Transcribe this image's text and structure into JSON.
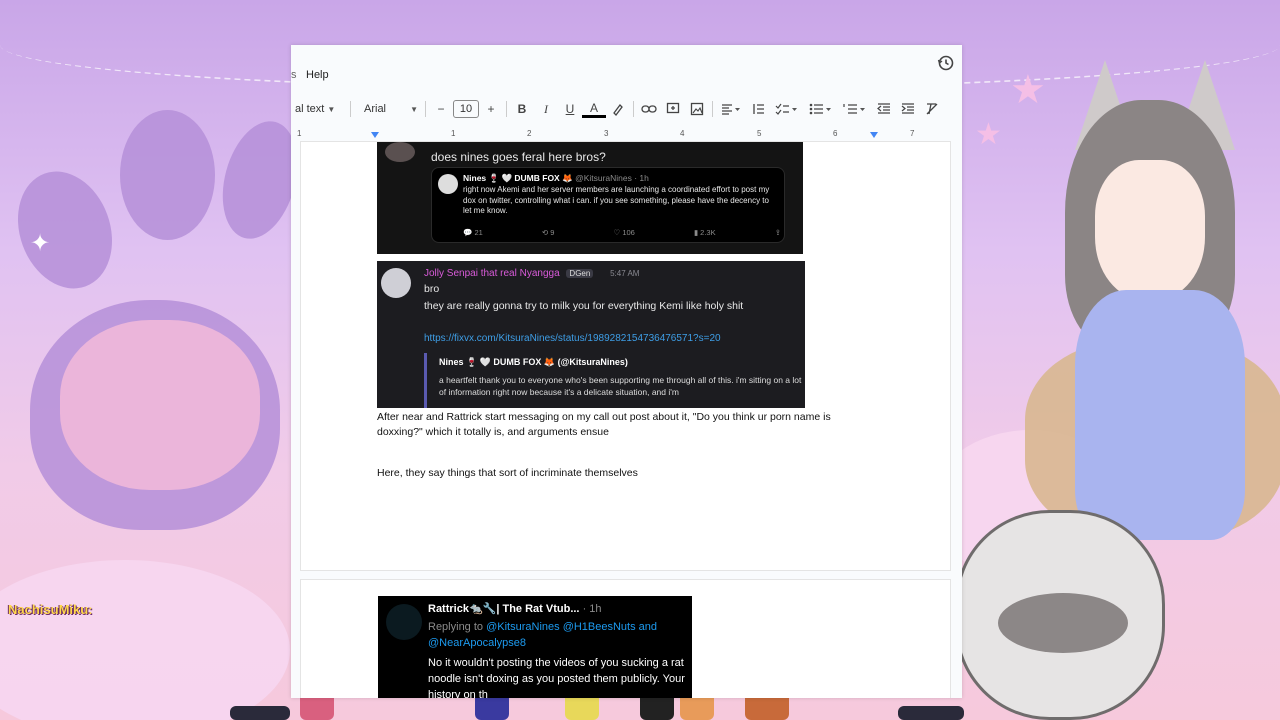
{
  "overlay": {
    "chat_user": "NachisuMiku:",
    "colors": {
      "bg_purple": "#c9a6e8",
      "paw": "#b58fd8",
      "pink": "#f1cbe8"
    }
  },
  "docs": {
    "menu": {
      "partial": "s",
      "help": "Help"
    },
    "history_icon": "history-icon",
    "toolbar": {
      "style_label": "al text",
      "font_label": "Arial",
      "font_size": "10",
      "decrease": "−",
      "increase": "+",
      "bold": "B",
      "italic": "I",
      "underline": "U",
      "textcolor": "A"
    },
    "ruler": [
      "1",
      "1",
      "2",
      "3",
      "4",
      "5",
      "6",
      "7"
    ],
    "shot1": {
      "question": "does nines goes feral here bros?",
      "tweet_name": "Nines 🍷 🤍 DUMB FOX 🦊",
      "tweet_handle": "@KitsuraNines · 1h",
      "tweet_body": "right now Akemi and her server members are launching a coordinated effort to post my dox on twitter, controlling what i can. if you see something, please have the decency to let me know.",
      "stats": [
        "21",
        "9",
        "106",
        "2.3K"
      ]
    },
    "shot2": {
      "user": "Jolly Senpai that real Nyangga",
      "tag": "DGen",
      "time": "5:47 AM",
      "line1": "bro",
      "line2": "they are really gonna try to milk you for everything Kemi like holy shit",
      "link": "https://fixvx.com/KitsuraNines/status/1989282154736476571?s=20",
      "embed_name": "Nines 🍷 🤍 DUMB FOX 🦊 (@KitsuraNines)",
      "embed_body": "a heartfelt thank you to everyone who's been supporting me through all of this. i'm sitting on a lot of information right now because it's a delicate situation, and i'm"
    },
    "para1": "After near and Rattrick start messaging on my call out post about it, \"Do you think ur porn name is doxxing?\" which it totally is, and arguments ensue",
    "para2": "Here, they say things that sort of incriminate themselves",
    "shot3": {
      "name": "Rattrick🐀🔧| The Rat Vtub...",
      "meta": "· 1h",
      "reply_prefix": "Replying to",
      "reply_mentions": "@KitsuraNines @H1BeesNuts",
      "reply_and": "and",
      "reply_mention2": "@NearApocalypse8",
      "body": "No it wouldn't posting the videos of you sucking a rat noodle isn't doxing as you posted them publicly. Your history on th"
    }
  }
}
